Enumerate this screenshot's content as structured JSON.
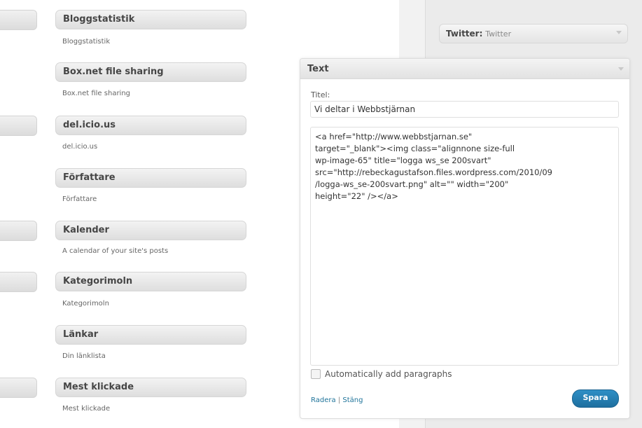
{
  "available_widgets": [
    {
      "title": "Bloggstatistik",
      "description": "Bloggstatistik"
    },
    {
      "title": "Box.net file sharing",
      "description": "Box.net file sharing"
    },
    {
      "title": "del.icio.us",
      "description": "del.icio.us"
    },
    {
      "title": "Författare",
      "description": "Författare"
    },
    {
      "title": "Kalender",
      "description": "A calendar of your site's posts"
    },
    {
      "title": "Kategorimoln",
      "description": "Kategorimoln"
    },
    {
      "title": "Länkar",
      "description": "Din länklista"
    },
    {
      "title": "Mest klickade",
      "description": "Mest klickade"
    }
  ],
  "sidebar": {
    "twitter_widget": {
      "title": "Twitter:",
      "subtitle": "Twitter"
    }
  },
  "text_widget": {
    "header": "Text",
    "title_label": "Titel:",
    "title_value": "Vi deltar i Webbstjärnan",
    "content": "<a href=\"http://www.webbstjarnan.se\"\ntarget=\"_blank\"><img class=\"alignnone size-full\nwp-image-65\" title=\"logga ws_se 200svart\"\nsrc=\"http://rebeckagustafson.files.wordpress.com/2010/09\n/logga-ws_se-200svart.png\" alt=\"\" width=\"200\"\nheight=\"22\" /></a>",
    "auto_paragraphs_label": "Automatically add paragraphs",
    "auto_paragraphs_checked": false,
    "delete_link": "Radera",
    "separator": "|",
    "close_link": "Stäng",
    "save_button": "Spara"
  }
}
